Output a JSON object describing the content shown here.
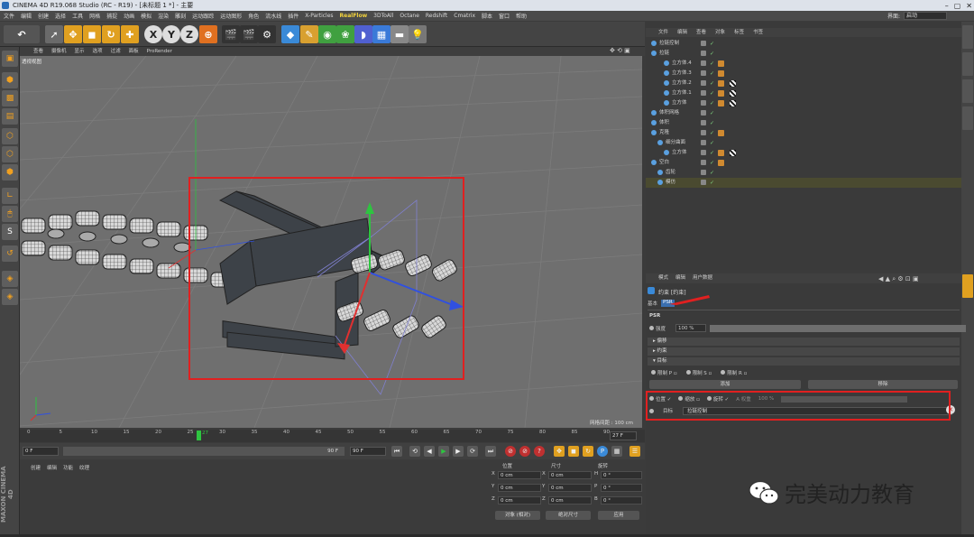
{
  "window": {
    "title": "CINEMA 4D R19.068 Studio (RC - R19) - [未标题 1 *] - 主要"
  },
  "menubar": {
    "items": [
      "文件",
      "编辑",
      "创建",
      "选择",
      "工具",
      "网格",
      "捕捉",
      "动画",
      "模拟",
      "渲染",
      "雕刻",
      "运动跟踪",
      "运动图形",
      "角色",
      "流水线",
      "插件",
      "X-Particles",
      "RealFlow",
      "3DToAll",
      "Octane",
      "Redshift",
      "Cmatrix",
      "脚本",
      "窗口",
      "帮助"
    ],
    "selected": "RealFlow",
    "layout_label": "界面:",
    "layout_value": "启动"
  },
  "viewport": {
    "menu": [
      "查看",
      "摄像机",
      "显示",
      "选项",
      "过滤",
      "面板",
      "ProRender"
    ],
    "label": "透视视图",
    "grid_info": "网格间距 : 100 cm"
  },
  "timeline": {
    "ticks": [
      "0",
      "5",
      "10",
      "15",
      "20",
      "25",
      "30",
      "35",
      "40",
      "45",
      "50",
      "55",
      "60",
      "65",
      "70",
      "75",
      "80",
      "85",
      "90"
    ],
    "current": "27",
    "current_frame_field": "27 F"
  },
  "playbar": {
    "start": "0 F",
    "min": "0 F",
    "max": "90 F",
    "end": "90 F"
  },
  "materials": {
    "menu": [
      "创建",
      "编辑",
      "功能",
      "纹理"
    ]
  },
  "maxon": "MAXON CINEMA 4D",
  "coords": {
    "headers": [
      "位置",
      "尺寸",
      "旋转"
    ],
    "rows": [
      {
        "a": "X",
        "pos": "0 cm",
        "b": "X",
        "size": "0 cm",
        "c": "H",
        "rot": "0 °"
      },
      {
        "a": "Y",
        "pos": "0 cm",
        "b": "Y",
        "size": "0 cm",
        "c": "P",
        "rot": "0 °"
      },
      {
        "a": "Z",
        "pos": "0 cm",
        "b": "Z",
        "size": "0 cm",
        "c": "B",
        "rot": "0 °"
      }
    ],
    "mode": "对象 (相对)",
    "size_mode": "绝对尺寸",
    "apply": "应用"
  },
  "objects": {
    "menu": [
      "文件",
      "编辑",
      "查看",
      "对象",
      "标签",
      "书签"
    ],
    "rows": [
      {
        "name": "拉链控制",
        "indent": 0,
        "tag": false,
        "tag2": false
      },
      {
        "name": "拉链",
        "indent": 0,
        "tag": false,
        "tag2": false
      },
      {
        "name": "立方体.4",
        "indent": 2,
        "tag": true,
        "tag2": false
      },
      {
        "name": "立方体.3",
        "indent": 2,
        "tag": true,
        "tag2": false
      },
      {
        "name": "立方体.2",
        "indent": 2,
        "tag": true,
        "tag2": true
      },
      {
        "name": "立方体.1",
        "indent": 2,
        "tag": true,
        "tag2": true
      },
      {
        "name": "立方体",
        "indent": 2,
        "tag": true,
        "tag2": true
      },
      {
        "name": "体积网格",
        "indent": 0,
        "tag": false,
        "tag2": false
      },
      {
        "name": "体积",
        "indent": 0,
        "tag": false,
        "tag2": false
      },
      {
        "name": "克隆",
        "indent": 0,
        "tag": true,
        "tag2": false
      },
      {
        "name": "细分曲面",
        "indent": 1,
        "tag": false,
        "tag2": false
      },
      {
        "name": "立方体",
        "indent": 2,
        "tag": true,
        "tag2": true
      },
      {
        "name": "空白",
        "indent": 0,
        "tag": true,
        "tag2": false
      },
      {
        "name": "齿轮",
        "indent": 1,
        "tag": false,
        "tag2": false
      },
      {
        "name": "模仿",
        "indent": 1,
        "tag": false,
        "tag2": false
      }
    ]
  },
  "attributes": {
    "menu": [
      "模式",
      "编辑",
      "用户数据"
    ],
    "object_title": "约束 [约束]",
    "tabs": [
      "基本",
      "PSR"
    ],
    "active_tab": "PSR",
    "section": "PSR",
    "strength_label": "强度",
    "strength_value": "100 %",
    "groups": [
      "偏移",
      "约束",
      "目标"
    ],
    "axes": [
      "限制 P",
      "限制 S",
      "限制 R"
    ],
    "add_button": "添加",
    "remove_button": "移除",
    "target": {
      "position": "位置",
      "scale": "缩放",
      "rotation": "旋转",
      "weight_label": "A 权重",
      "weight_value": "100 %",
      "target_label": "目标",
      "target_value": "拉链控制"
    }
  },
  "watermark": "完美动力教育"
}
